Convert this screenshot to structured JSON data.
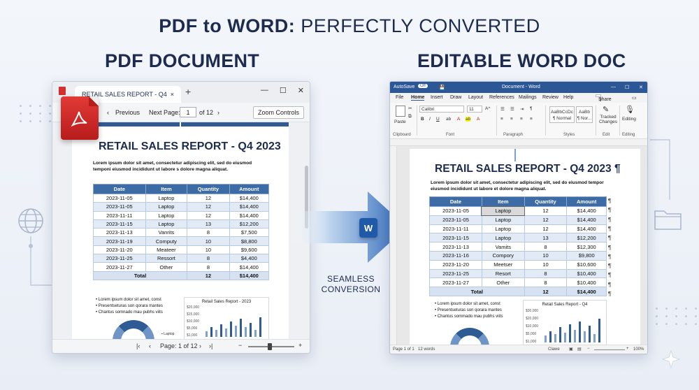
{
  "headline": {
    "bold": "PDF to WORD:",
    "light": "PERFECTLY CONVERTED"
  },
  "pdf_column_title": "PDF DOCUMENT",
  "word_column_title": "EDITABLE WORD DOC",
  "arrow_caption": [
    "SEAMLESS",
    "CONVERSION"
  ],
  "word_badge": "W",
  "pdf_viewer": {
    "tab_title": "RETAIL SALES REPORT - Q4",
    "tab_close": "×",
    "new_tab": "+",
    "window_controls": [
      "—",
      "☐",
      "✕"
    ],
    "previous": "Previous",
    "next_label": "Next Page:",
    "page_value": "1",
    "page_of": "of 12",
    "zoom_controls": "Zoom Controls",
    "status_page": "Page: 1 of 12",
    "status_minus": "−",
    "status_plus": "+",
    "report_title": "RETAIL SALES REPORT - Q4 2023",
    "lorem": "Lorem ipsum dolor sit amet, consectetur adipiscing elit, sed do eiusmod temponi eiusmod incididunt ut labore s dolore magna aliquat.",
    "table_headers": [
      "Date",
      "Item",
      "Quantity",
      "Amount"
    ],
    "table_rows": [
      [
        "2023-11-05",
        "Laptop",
        "12",
        "$14,400"
      ],
      [
        "2023-11-05",
        "Laptop",
        "12",
        "$14,400"
      ],
      [
        "2023-11-11",
        "Laptop",
        "12",
        "$14,400"
      ],
      [
        "2023-11-15",
        "Laptop",
        "13",
        "$12,200"
      ],
      [
        "2023-11-13",
        "Vanrits",
        "8",
        "$7,500"
      ],
      [
        "2023-11-19",
        "Computy",
        "10",
        "$8,800"
      ],
      [
        "2023-11-20",
        "Meateer",
        "10",
        "$9,600"
      ],
      [
        "2023-11-25",
        "Ressort",
        "8",
        "$4,400"
      ],
      [
        "2023-11-27",
        "Other",
        "8",
        "$14,400"
      ]
    ],
    "table_total": [
      "Total",
      "12",
      "$14,400"
    ],
    "bullets": [
      "Lorem ipsum dolor sit amet, const",
      "Presentseturas son qorara mantes",
      "Chantus somnado mau pubhs viits"
    ],
    "chart_title": "Retail Sales Report - 2023",
    "chart_yticks": [
      "$20,000",
      "$15,000",
      "$10,000",
      "$5,000",
      "$1,000"
    ],
    "laptop_legend": "Laptop"
  },
  "word_window": {
    "autosave": "AutoSave",
    "autosave_state": "Off",
    "title": "Document - Word",
    "tabs": [
      "File",
      "Home",
      "Insert",
      "Draw",
      "Layout",
      "References",
      "Mailings",
      "Review",
      "Help"
    ],
    "share": "Share",
    "font_name": "Calibri",
    "font_size": "11",
    "paste": "Paste",
    "styles_box_1": [
      "AaBbCcDc",
      "¶ Normal"
    ],
    "styles_box_2": [
      "AaBb",
      "¶ Nor..."
    ],
    "tracked_changes": "Tracked Changes",
    "editing": "Editing",
    "group_labels": [
      "Clipboard",
      "Font",
      "Paragraph",
      "Styles",
      "Edit",
      "Editing"
    ],
    "report_title": "RETAIL SALES REPORT - Q4 2023 ¶",
    "lorem": "Lorem ipsum dolor sit amet, consectetur adipiscing elit, sed do eiusmod tempor eiusmod incididunt ut labore et dolore magna aliquat.",
    "table_headers": [
      "Date",
      "Item",
      "Quantity",
      "Amount"
    ],
    "table_rows": [
      [
        "2023-11-05",
        "Laptop",
        "12",
        "$14,400"
      ],
      [
        "2023-11-05",
        "Laptop",
        "12",
        "$14,400"
      ],
      [
        "2023-11-11",
        "Laptop",
        "12",
        "$14,400"
      ],
      [
        "2023-11-15",
        "Laptop",
        "13",
        "$12,200"
      ],
      [
        "2023-11-13",
        "Vamits",
        "8",
        "$12,300"
      ],
      [
        "2023-11-16",
        "Compory",
        "10",
        "$9,800"
      ],
      [
        "2023-11-20",
        "Meetser",
        "10",
        "$10,600"
      ],
      [
        "2023-11-25",
        "Resort",
        "8",
        "$10,400"
      ],
      [
        "2023-11-27",
        "Other",
        "8",
        "$10,400"
      ]
    ],
    "table_total": [
      "Total",
      "12",
      "$14,400"
    ],
    "bullets": [
      "Lorem ipsum dolor sit amet, const",
      "Presentseturas son qorara mantes",
      "Chantus sommado mau pubhs viits"
    ],
    "chart_title": "Retail Sales Report - Q4",
    "chart_yticks": [
      "$30,000",
      "$20,000",
      "$10,000",
      "$5,000",
      "$1,000"
    ],
    "status_page": "Page 1 of 1",
    "status_words": "12 words",
    "status_view": "Clawe",
    "status_zoom": "100%"
  },
  "colors": {
    "accent": "#2f5b94",
    "table_header": "#3c6ba5",
    "pdf_red": "#d32f2f",
    "word_blue": "#2b5797"
  },
  "icons": [
    "pdf-file-icon",
    "acrobat-icon",
    "word-icon",
    "globe-icon",
    "folder-icon",
    "sparkle-icon",
    "arrow-right-icon"
  ]
}
